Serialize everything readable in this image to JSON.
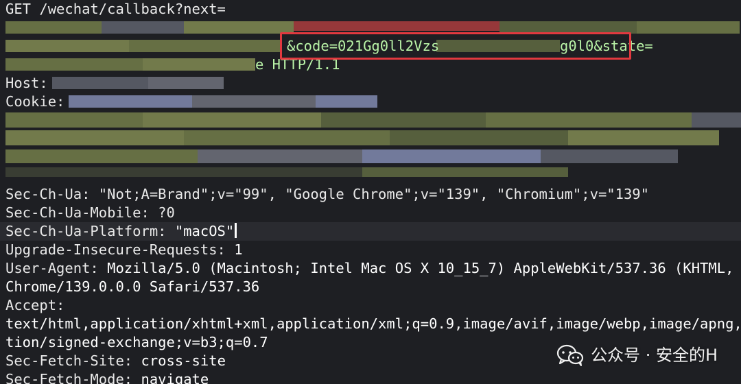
{
  "request": {
    "line1": "GET /wechat/callback?next=",
    "code_segment": "&code=021Gg0ll2Vzs",
    "code_tail": "g0l0&state=",
    "line4_tail": "e HTTP/1.1"
  },
  "headers": {
    "host_label": "Host:",
    "cookie_label": "Cookie:",
    "sec_ch_ua": "Sec-Ch-Ua: \"Not;A=Brand\";v=\"99\", \"Google Chrome\";v=\"139\", \"Chromium\";v=\"139\"",
    "sec_ch_ua_mobile": "Sec-Ch-Ua-Mobile: ?0",
    "sec_ch_ua_platform_label": "Sec-Ch-Ua-Platform: ",
    "sec_ch_ua_platform_value": "\"macOS\"",
    "upgrade_insecure_label": "Upgrade-Insecure-Requests: ",
    "upgrade_insecure_value": "1",
    "user_agent_label": "User-Agent: ",
    "user_agent_value": "Mozilla/5.0 (Macintosh; Intel Mac OS X 10_15_7) AppleWebKit/537.36 (KHTML, like",
    "user_agent_cont": "Chrome/139.0.0.0 Safari/537.36",
    "accept_label": "Accept:",
    "accept_value": "text/html,application/xhtml+xml,application/xml;q=0.9,image/avif,image/webp,image/apng,*/*;",
    "accept_cont": "tion/signed-exchange;v=b3;q=0.7",
    "sec_fetch_site_label": "Sec-Fetch-Site: ",
    "sec_fetch_site_value": "cross-site",
    "sec_fetch_mode_label": "Sec-Fetch-Mode: ",
    "sec_fetch_mode_value": "navigate"
  },
  "watermark": {
    "text": "公众号 · 安全的H",
    "icon": "wechat-icon"
  },
  "colors": {
    "background": "#1e1f23",
    "highlight_border": "#e2393f",
    "text": "#e6e6e6"
  }
}
